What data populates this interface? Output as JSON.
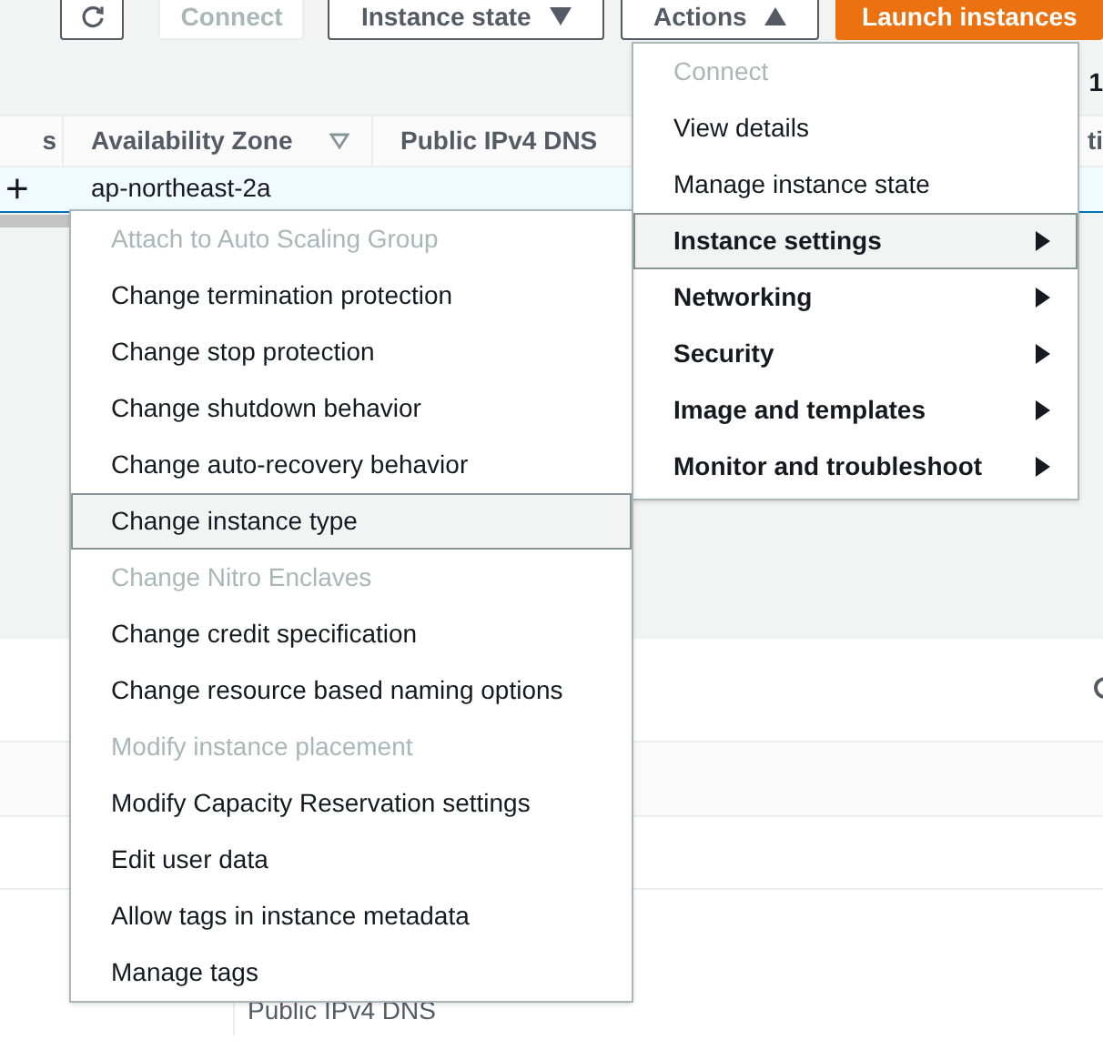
{
  "toolbar": {
    "refresh": {
      "kind": "icon"
    },
    "buttons": [
      {
        "label": "Connect",
        "kind": "plain",
        "disabled": true
      },
      {
        "label": "Instance state",
        "kind": "dropdown",
        "disabled": false,
        "expanded": false
      },
      {
        "label": "Actions",
        "kind": "dropdown",
        "disabled": false,
        "expanded": true
      },
      {
        "label": "Launch instances",
        "kind": "primary",
        "disabled": false
      }
    ]
  },
  "selection_count": "1",
  "table": {
    "columns": [
      {
        "label": "s",
        "kind": "plain"
      },
      {
        "label": "Availability Zone",
        "kind": "sortable"
      },
      {
        "label": "Public IPv4 DNS",
        "kind": "plain"
      },
      {
        "label": "ti",
        "kind": "plain"
      }
    ],
    "rows": [
      {
        "cells": [
          "+",
          "ap-northeast-2a"
        ],
        "selected": true
      }
    ]
  },
  "actions_menu": {
    "items": [
      {
        "label": "Connect",
        "kind": "item",
        "disabled": true,
        "selected": false
      },
      {
        "label": "View details",
        "kind": "item",
        "disabled": false,
        "selected": false
      },
      {
        "label": "Manage instance state",
        "kind": "item",
        "disabled": false,
        "selected": false
      },
      {
        "label": "Instance settings",
        "kind": "submenu",
        "disabled": false,
        "selected": true
      },
      {
        "label": "Networking",
        "kind": "submenu",
        "disabled": false,
        "selected": false
      },
      {
        "label": "Security",
        "kind": "submenu",
        "disabled": false,
        "selected": false
      },
      {
        "label": "Image and templates",
        "kind": "submenu",
        "disabled": false,
        "selected": false
      },
      {
        "label": "Monitor and troubleshoot",
        "kind": "submenu",
        "disabled": false,
        "selected": false
      }
    ]
  },
  "instance_settings_menu": {
    "items": [
      {
        "label": "Attach to Auto Scaling Group",
        "disabled": true,
        "selected": false
      },
      {
        "label": "Change termination protection",
        "disabled": false,
        "selected": false
      },
      {
        "label": "Change stop protection",
        "disabled": false,
        "selected": false
      },
      {
        "label": "Change shutdown behavior",
        "disabled": false,
        "selected": false
      },
      {
        "label": "Change auto-recovery behavior",
        "disabled": false,
        "selected": false
      },
      {
        "label": "Change instance type",
        "disabled": false,
        "selected": true
      },
      {
        "label": "Change Nitro Enclaves",
        "disabled": true,
        "selected": false
      },
      {
        "label": "Change credit specification",
        "disabled": false,
        "selected": false
      },
      {
        "label": "Change resource based naming options",
        "disabled": false,
        "selected": false
      },
      {
        "label": "Modify instance placement",
        "disabled": true,
        "selected": false
      },
      {
        "label": "Modify Capacity Reservation settings",
        "disabled": false,
        "selected": false
      },
      {
        "label": "Edit user data",
        "disabled": false,
        "selected": false
      },
      {
        "label": "Allow tags in instance metadata",
        "disabled": false,
        "selected": false
      },
      {
        "label": "Manage tags",
        "disabled": false,
        "selected": false
      }
    ]
  },
  "details": {
    "label": "Public IPv4 DNS"
  }
}
